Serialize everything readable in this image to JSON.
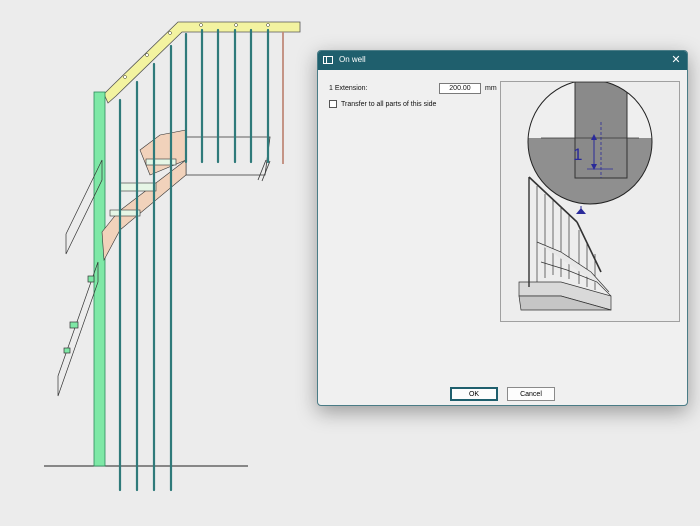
{
  "dialog": {
    "title": "On well",
    "close_glyph": "✕",
    "extension_label": "1 Extension:",
    "extension_value": "200.00",
    "extension_unit": "mm",
    "transfer_label": "Transfer to all parts of this side",
    "transfer_checked": false,
    "preview_marker": "1",
    "ok_label": "OK",
    "cancel_label": "Cancel"
  },
  "icons": {
    "title": "window-icon",
    "close": "close-icon"
  },
  "colors": {
    "titlebar": "#1f5f6d",
    "handrail": "#f3f3a0",
    "newel_post": "#7ee8a6",
    "balusters": "#2f7a7a",
    "tread_hatch": "#f1c8a8"
  }
}
